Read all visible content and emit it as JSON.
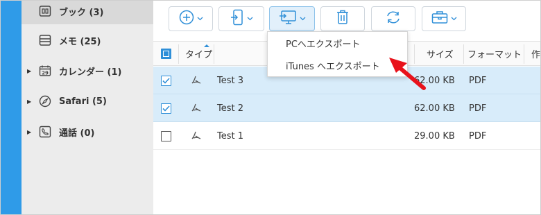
{
  "sidebar": {
    "items": [
      {
        "label": "ブック (3)",
        "icon": "book-icon",
        "active": true,
        "expandable": false
      },
      {
        "label": "メモ (25)",
        "icon": "notes-icon",
        "active": false,
        "expandable": false
      },
      {
        "label": "カレンダー (1)",
        "icon": "calendar-icon",
        "active": false,
        "expandable": true
      },
      {
        "label": "Safari (5)",
        "icon": "compass-icon",
        "active": false,
        "expandable": true
      },
      {
        "label": "通話 (0)",
        "icon": "phone-icon",
        "active": false,
        "expandable": true
      }
    ],
    "calendar_day": "29"
  },
  "toolbar": {
    "buttons": [
      "add-button",
      "import-device-button",
      "export-button",
      "delete-button",
      "sync-button",
      "toolbox-button"
    ],
    "active": "export-button"
  },
  "export_menu": {
    "items": [
      "PCへエクスポート",
      "iTunes へエクスポート"
    ]
  },
  "table": {
    "columns": {
      "type": "タイプ",
      "size": "サイズ",
      "format": "フォーマット",
      "extra": "作"
    },
    "rows": [
      {
        "name": "Test 3",
        "size": "62.00 KB",
        "format": "PDF",
        "checked": true
      },
      {
        "name": "Test 2",
        "size": "62.00 KB",
        "format": "PDF",
        "checked": true
      },
      {
        "name": "Test 1",
        "size": "29.00 KB",
        "format": "PDF",
        "checked": false
      }
    ]
  },
  "colors": {
    "accent": "#2f8fd8",
    "strip": "#2f9be8",
    "selected_row": "#d8ecfa",
    "pointer": "#e8121b"
  }
}
